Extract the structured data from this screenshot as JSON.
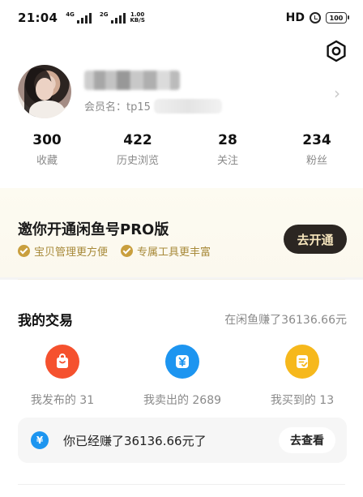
{
  "status_bar": {
    "time": "21:04",
    "sim1_tag": "4G",
    "sim2_tag": "2G",
    "net_speed_value": "1.00",
    "net_speed_unit": "KB/S",
    "hd_label": "HD",
    "battery": "100"
  },
  "profile": {
    "member_label": "会员名：tp15",
    "chevron": "›"
  },
  "stats": [
    {
      "value": "300",
      "label": "收藏"
    },
    {
      "value": "422",
      "label": "历史浏览"
    },
    {
      "value": "28",
      "label": "关注"
    },
    {
      "value": "234",
      "label": "粉丝"
    }
  ],
  "pro": {
    "title": "邀你开通闲鱼号PRO版",
    "features": [
      "宝贝管理更方便",
      "专属工具更丰富"
    ],
    "button": "去开通",
    "accent": "#c99f3e"
  },
  "trade": {
    "title": "我的交易",
    "earned_summary": "在闲鱼赚了36136.66元",
    "items": [
      {
        "label": "我发布的 31",
        "icon": "bag-icon",
        "color": "#f5512e"
      },
      {
        "label": "我卖出的 2689",
        "icon": "yuan-icon",
        "color": "#1d95f0"
      },
      {
        "label": "我买到的 13",
        "icon": "receipt-icon",
        "color": "#f6b81c"
      }
    ],
    "earn_bar": {
      "coin": "¥",
      "text": "你已经赚了36136.66元了",
      "button": "去查看"
    }
  }
}
